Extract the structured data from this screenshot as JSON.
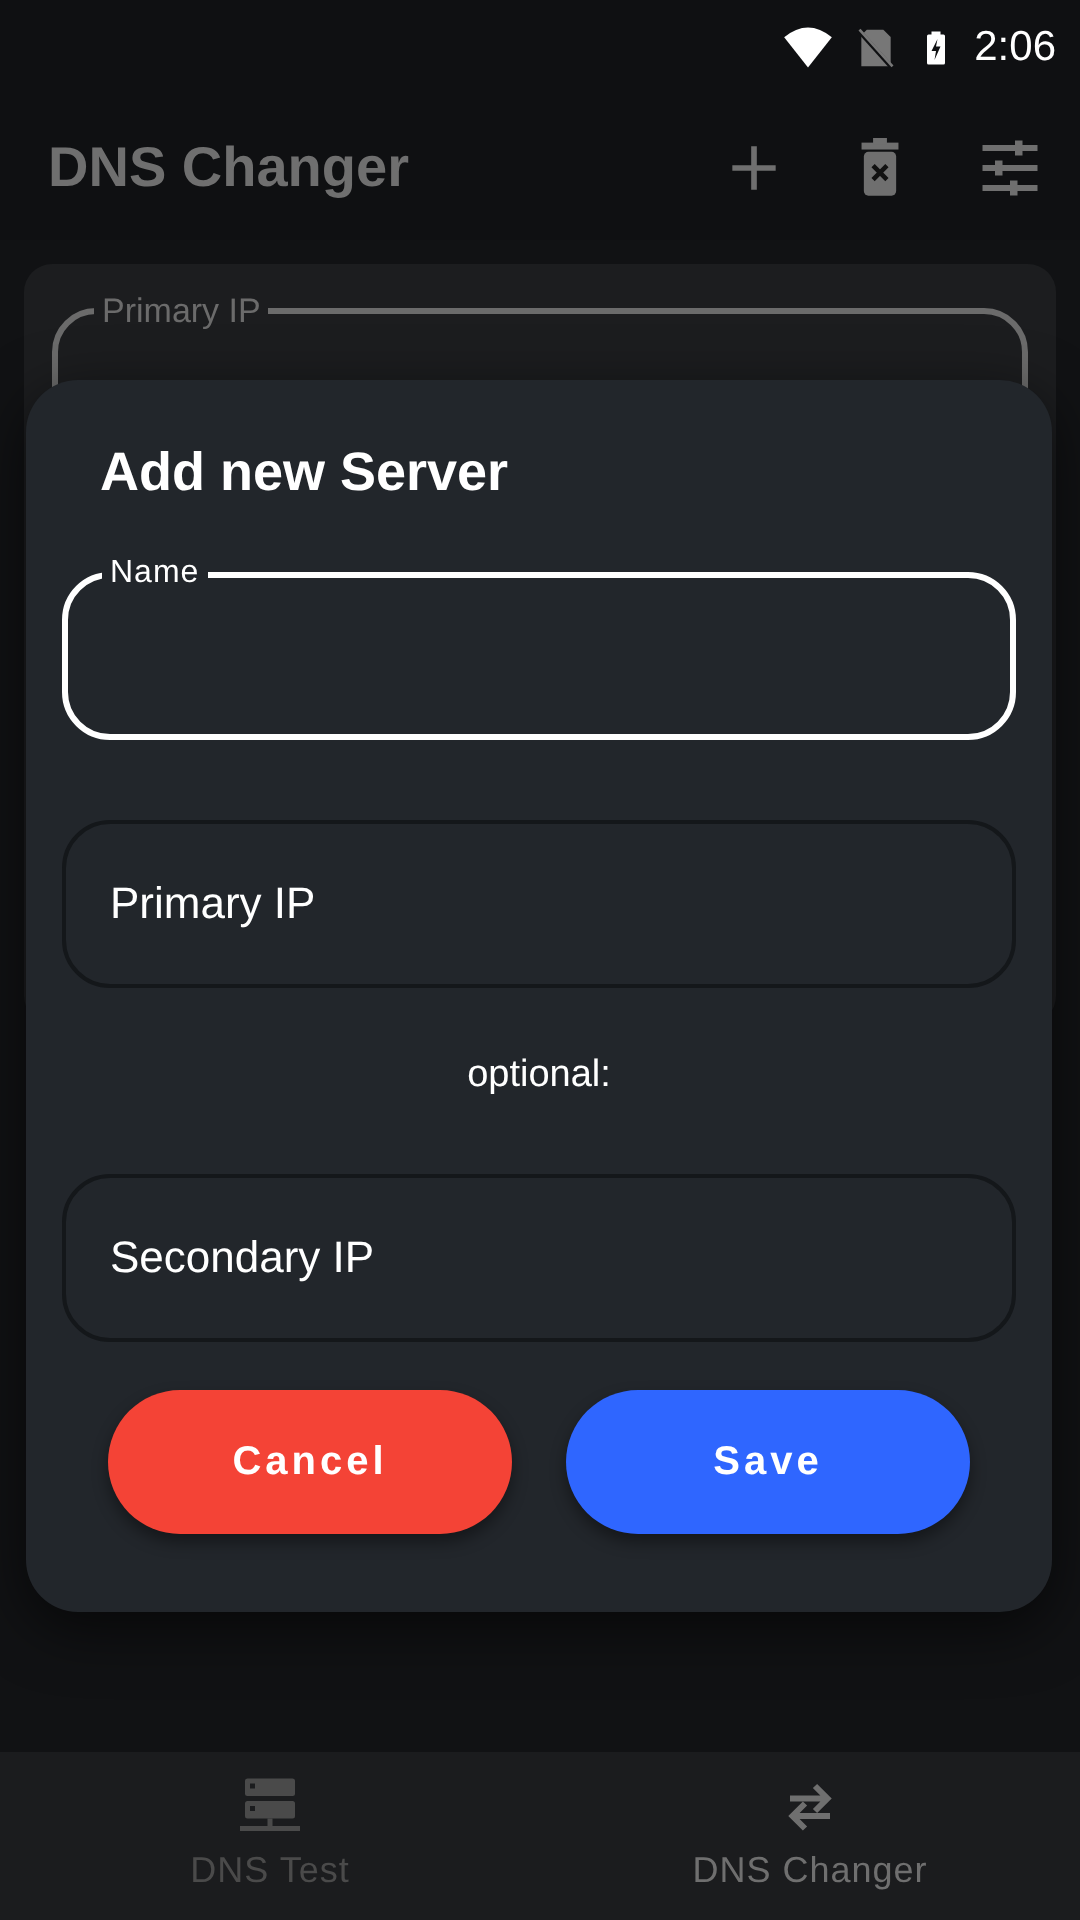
{
  "status_bar": {
    "time": "2:06"
  },
  "app_bar": {
    "title": "DNS Changer"
  },
  "background_card": {
    "field_label": "Primary IP"
  },
  "dialog": {
    "title": "Add new Server",
    "fields": [
      {
        "label": "Name",
        "focused": true
      },
      {
        "placeholder": "Primary IP",
        "focused": false
      },
      {
        "note": "optional:",
        "placeholder": "Secondary IP",
        "focused": false
      }
    ],
    "buttons": [
      {
        "label": "Cancel",
        "color": "#f44336"
      },
      {
        "label": "Save",
        "color": "#2f66ff"
      }
    ]
  },
  "bottom_nav": [
    {
      "label": "DNS Test",
      "selected": false
    },
    {
      "label": "DNS Changer",
      "selected": true
    }
  ]
}
